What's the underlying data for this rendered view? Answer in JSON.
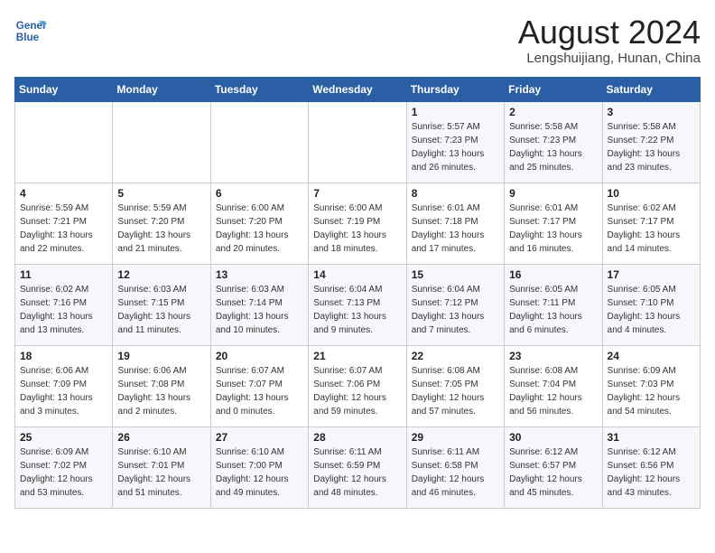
{
  "header": {
    "logo_line1": "General",
    "logo_line2": "Blue",
    "month_title": "August 2024",
    "location": "Lengshuijiang, Hunan, China"
  },
  "days_of_week": [
    "Sunday",
    "Monday",
    "Tuesday",
    "Wednesday",
    "Thursday",
    "Friday",
    "Saturday"
  ],
  "weeks": [
    [
      {
        "day": "",
        "info": ""
      },
      {
        "day": "",
        "info": ""
      },
      {
        "day": "",
        "info": ""
      },
      {
        "day": "",
        "info": ""
      },
      {
        "day": "1",
        "info": "Sunrise: 5:57 AM\nSunset: 7:23 PM\nDaylight: 13 hours\nand 26 minutes."
      },
      {
        "day": "2",
        "info": "Sunrise: 5:58 AM\nSunset: 7:23 PM\nDaylight: 13 hours\nand 25 minutes."
      },
      {
        "day": "3",
        "info": "Sunrise: 5:58 AM\nSunset: 7:22 PM\nDaylight: 13 hours\nand 23 minutes."
      }
    ],
    [
      {
        "day": "4",
        "info": "Sunrise: 5:59 AM\nSunset: 7:21 PM\nDaylight: 13 hours\nand 22 minutes."
      },
      {
        "day": "5",
        "info": "Sunrise: 5:59 AM\nSunset: 7:20 PM\nDaylight: 13 hours\nand 21 minutes."
      },
      {
        "day": "6",
        "info": "Sunrise: 6:00 AM\nSunset: 7:20 PM\nDaylight: 13 hours\nand 20 minutes."
      },
      {
        "day": "7",
        "info": "Sunrise: 6:00 AM\nSunset: 7:19 PM\nDaylight: 13 hours\nand 18 minutes."
      },
      {
        "day": "8",
        "info": "Sunrise: 6:01 AM\nSunset: 7:18 PM\nDaylight: 13 hours\nand 17 minutes."
      },
      {
        "day": "9",
        "info": "Sunrise: 6:01 AM\nSunset: 7:17 PM\nDaylight: 13 hours\nand 16 minutes."
      },
      {
        "day": "10",
        "info": "Sunrise: 6:02 AM\nSunset: 7:17 PM\nDaylight: 13 hours\nand 14 minutes."
      }
    ],
    [
      {
        "day": "11",
        "info": "Sunrise: 6:02 AM\nSunset: 7:16 PM\nDaylight: 13 hours\nand 13 minutes."
      },
      {
        "day": "12",
        "info": "Sunrise: 6:03 AM\nSunset: 7:15 PM\nDaylight: 13 hours\nand 11 minutes."
      },
      {
        "day": "13",
        "info": "Sunrise: 6:03 AM\nSunset: 7:14 PM\nDaylight: 13 hours\nand 10 minutes."
      },
      {
        "day": "14",
        "info": "Sunrise: 6:04 AM\nSunset: 7:13 PM\nDaylight: 13 hours\nand 9 minutes."
      },
      {
        "day": "15",
        "info": "Sunrise: 6:04 AM\nSunset: 7:12 PM\nDaylight: 13 hours\nand 7 minutes."
      },
      {
        "day": "16",
        "info": "Sunrise: 6:05 AM\nSunset: 7:11 PM\nDaylight: 13 hours\nand 6 minutes."
      },
      {
        "day": "17",
        "info": "Sunrise: 6:05 AM\nSunset: 7:10 PM\nDaylight: 13 hours\nand 4 minutes."
      }
    ],
    [
      {
        "day": "18",
        "info": "Sunrise: 6:06 AM\nSunset: 7:09 PM\nDaylight: 13 hours\nand 3 minutes."
      },
      {
        "day": "19",
        "info": "Sunrise: 6:06 AM\nSunset: 7:08 PM\nDaylight: 13 hours\nand 2 minutes."
      },
      {
        "day": "20",
        "info": "Sunrise: 6:07 AM\nSunset: 7:07 PM\nDaylight: 13 hours\nand 0 minutes."
      },
      {
        "day": "21",
        "info": "Sunrise: 6:07 AM\nSunset: 7:06 PM\nDaylight: 12 hours\nand 59 minutes."
      },
      {
        "day": "22",
        "info": "Sunrise: 6:08 AM\nSunset: 7:05 PM\nDaylight: 12 hours\nand 57 minutes."
      },
      {
        "day": "23",
        "info": "Sunrise: 6:08 AM\nSunset: 7:04 PM\nDaylight: 12 hours\nand 56 minutes."
      },
      {
        "day": "24",
        "info": "Sunrise: 6:09 AM\nSunset: 7:03 PM\nDaylight: 12 hours\nand 54 minutes."
      }
    ],
    [
      {
        "day": "25",
        "info": "Sunrise: 6:09 AM\nSunset: 7:02 PM\nDaylight: 12 hours\nand 53 minutes."
      },
      {
        "day": "26",
        "info": "Sunrise: 6:10 AM\nSunset: 7:01 PM\nDaylight: 12 hours\nand 51 minutes."
      },
      {
        "day": "27",
        "info": "Sunrise: 6:10 AM\nSunset: 7:00 PM\nDaylight: 12 hours\nand 49 minutes."
      },
      {
        "day": "28",
        "info": "Sunrise: 6:11 AM\nSunset: 6:59 PM\nDaylight: 12 hours\nand 48 minutes."
      },
      {
        "day": "29",
        "info": "Sunrise: 6:11 AM\nSunset: 6:58 PM\nDaylight: 12 hours\nand 46 minutes."
      },
      {
        "day": "30",
        "info": "Sunrise: 6:12 AM\nSunset: 6:57 PM\nDaylight: 12 hours\nand 45 minutes."
      },
      {
        "day": "31",
        "info": "Sunrise: 6:12 AM\nSunset: 6:56 PM\nDaylight: 12 hours\nand 43 minutes."
      }
    ]
  ]
}
